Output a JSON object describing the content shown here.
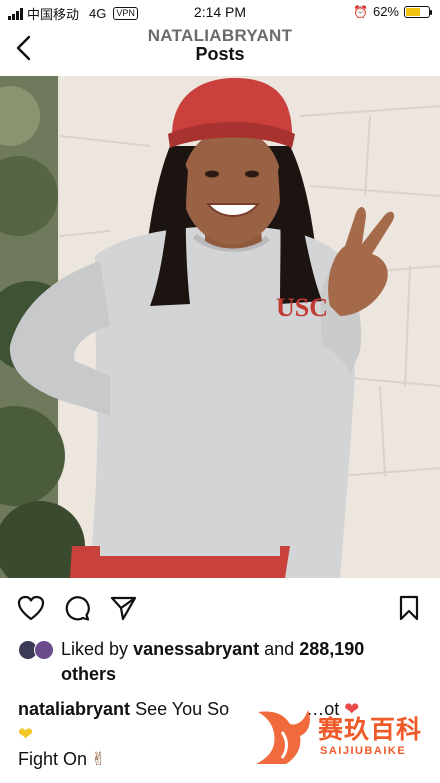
{
  "status_bar": {
    "carrier": "中国移动",
    "network": "4G",
    "vpn": "VPN",
    "time": "2:14 PM",
    "battery": "62%",
    "battery_level": 0.62,
    "battery_color": "#f1c40f"
  },
  "header": {
    "username": "NATALIABRYANT",
    "title": "Posts"
  },
  "post": {
    "likes": {
      "prefix": "Liked by",
      "user": "vanessabryant",
      "middle": "and",
      "count": "288,190",
      "suffix": "others"
    },
    "caption": {
      "user": "nataliabryant",
      "text": "See You So",
      "tail": "…ot"
    },
    "caption_line2": "Fight On"
  },
  "watermark": {
    "cn": "赛玖百科",
    "en": "SAIJIUBAIKE"
  },
  "colors": {
    "cap": "#c9403c",
    "sweatshirt": "#d3d4d6",
    "usc_text": "#c03a33",
    "watermark": "#f05a28"
  }
}
